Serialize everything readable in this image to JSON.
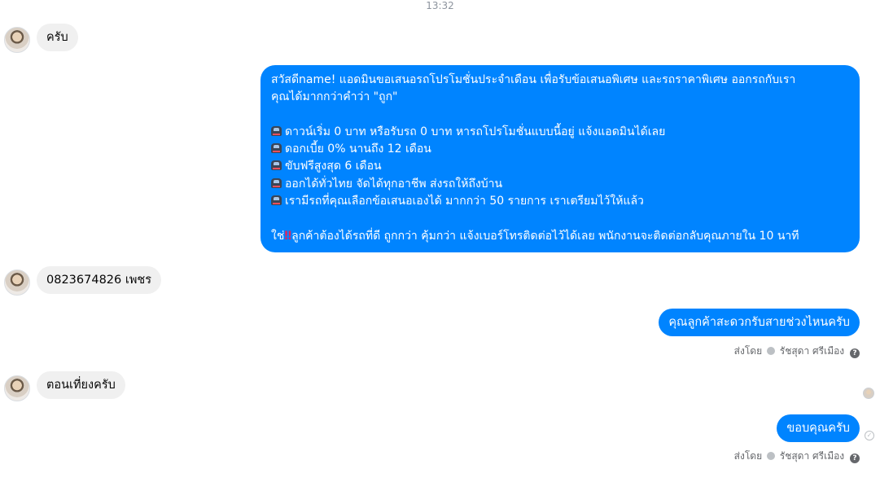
{
  "timestamp": "13:32",
  "messages": {
    "m1": "ครับ",
    "m2": {
      "lines": [
        "สวัสดีname! แอดมินขอเสนอรถโปรโมชั่นประจำเดือน เพื่อรับข้อเสนอพิเศษ และรถราคาพิเศษ ออกรถกับเรา",
        "คุณได้มากกว่าคำว่า \"ถูก\"",
        "",
        "ดาวน์เริ่ม 0 บาท หรือรับรถ 0 บาท หารถโปรโมชั่นแบบนี้อยู่ แจ้งแอดมินได้เลย",
        "ดอกเบี้ย 0% นานถึง 12 เดือน",
        "ขับฟรีสูงสุด 6 เดือน",
        "ออกได้ทั่วไทย จัดได้ทุกอาชีพ ส่งรถให้ถึงบ้าน",
        "เรามีรถที่คุณเลือกข้อเสนอเองได้ มากกว่า 50 รายการ เราเตรียมไว้ให้แล้ว",
        "",
        "ใช่",
        "‼",
        "ลูกค้าต้องได้รถที่ดี ถูกกว่า คุ้มกว่า แจ้งเบอร์โทรติดต่อไว้ได้เลย พนักงานจะติดต่อกลับคุณภายใน 10 นาที"
      ]
    },
    "m3": "0823674826 เพชร",
    "m4": "คุณลูกค้าสะดวกรับสายช่วงไหนครับ",
    "m5": "ตอนเที่ยงครับ",
    "m6": "ขอบคุณครับ"
  },
  "sent_by": {
    "prefix": "ส่งโดย",
    "name": "รัชสุดา ศรีเมือง",
    "help": "?"
  },
  "icons": {
    "car": "car-emoji-icon",
    "seen": "seen-avatar-icon",
    "delivered": "delivered-check-icon"
  },
  "colors": {
    "outgoing": "#0084ff",
    "incoming": "#f0f0f0"
  }
}
